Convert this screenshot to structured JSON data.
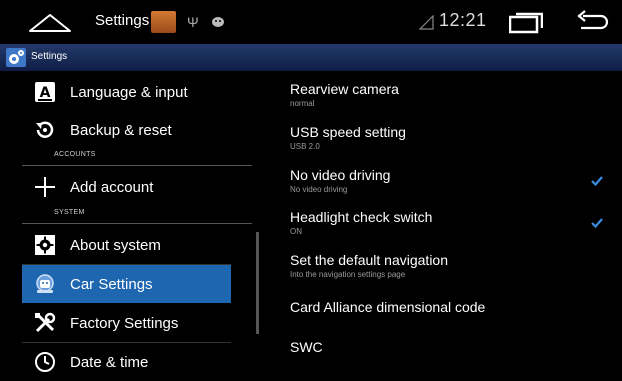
{
  "statusbar": {
    "title": "Settings",
    "time": "12:21"
  },
  "actionbar": {
    "title": "Settings"
  },
  "nav": {
    "items": [
      {
        "label": "Language & input",
        "icon": "language-icon"
      },
      {
        "label": "Backup & reset",
        "icon": "backup-reset-icon"
      },
      {
        "label": "Add account",
        "icon": "plus-icon"
      },
      {
        "label": "About system",
        "icon": "about-system-icon"
      },
      {
        "label": "Car Settings",
        "icon": "car-settings-icon",
        "selected": true
      },
      {
        "label": "Factory Settings",
        "icon": "tools-icon"
      },
      {
        "label": "Date & time",
        "icon": "clock-icon"
      }
    ],
    "sections": {
      "accounts": "ACCOUNTS",
      "system": "SYSTEM"
    }
  },
  "settings": {
    "rows": [
      {
        "title": "Rearview camera",
        "summary": "normal"
      },
      {
        "title": "USB speed setting",
        "summary": "USB 2.0"
      },
      {
        "title": "No video driving",
        "summary": "No video driving",
        "checked": true
      },
      {
        "title": "Headlight check switch",
        "summary": "ON",
        "checked": true
      },
      {
        "title": "Set the default navigation",
        "summary": "Into the navigation settings page"
      },
      {
        "title": "Card Alliance dimensional code",
        "summary": ""
      },
      {
        "title": "SWC",
        "summary": ""
      }
    ]
  },
  "colors": {
    "selected": "#1f66b0",
    "actionbar": "#1a2f5e",
    "checkbox": "#3a8de0"
  }
}
